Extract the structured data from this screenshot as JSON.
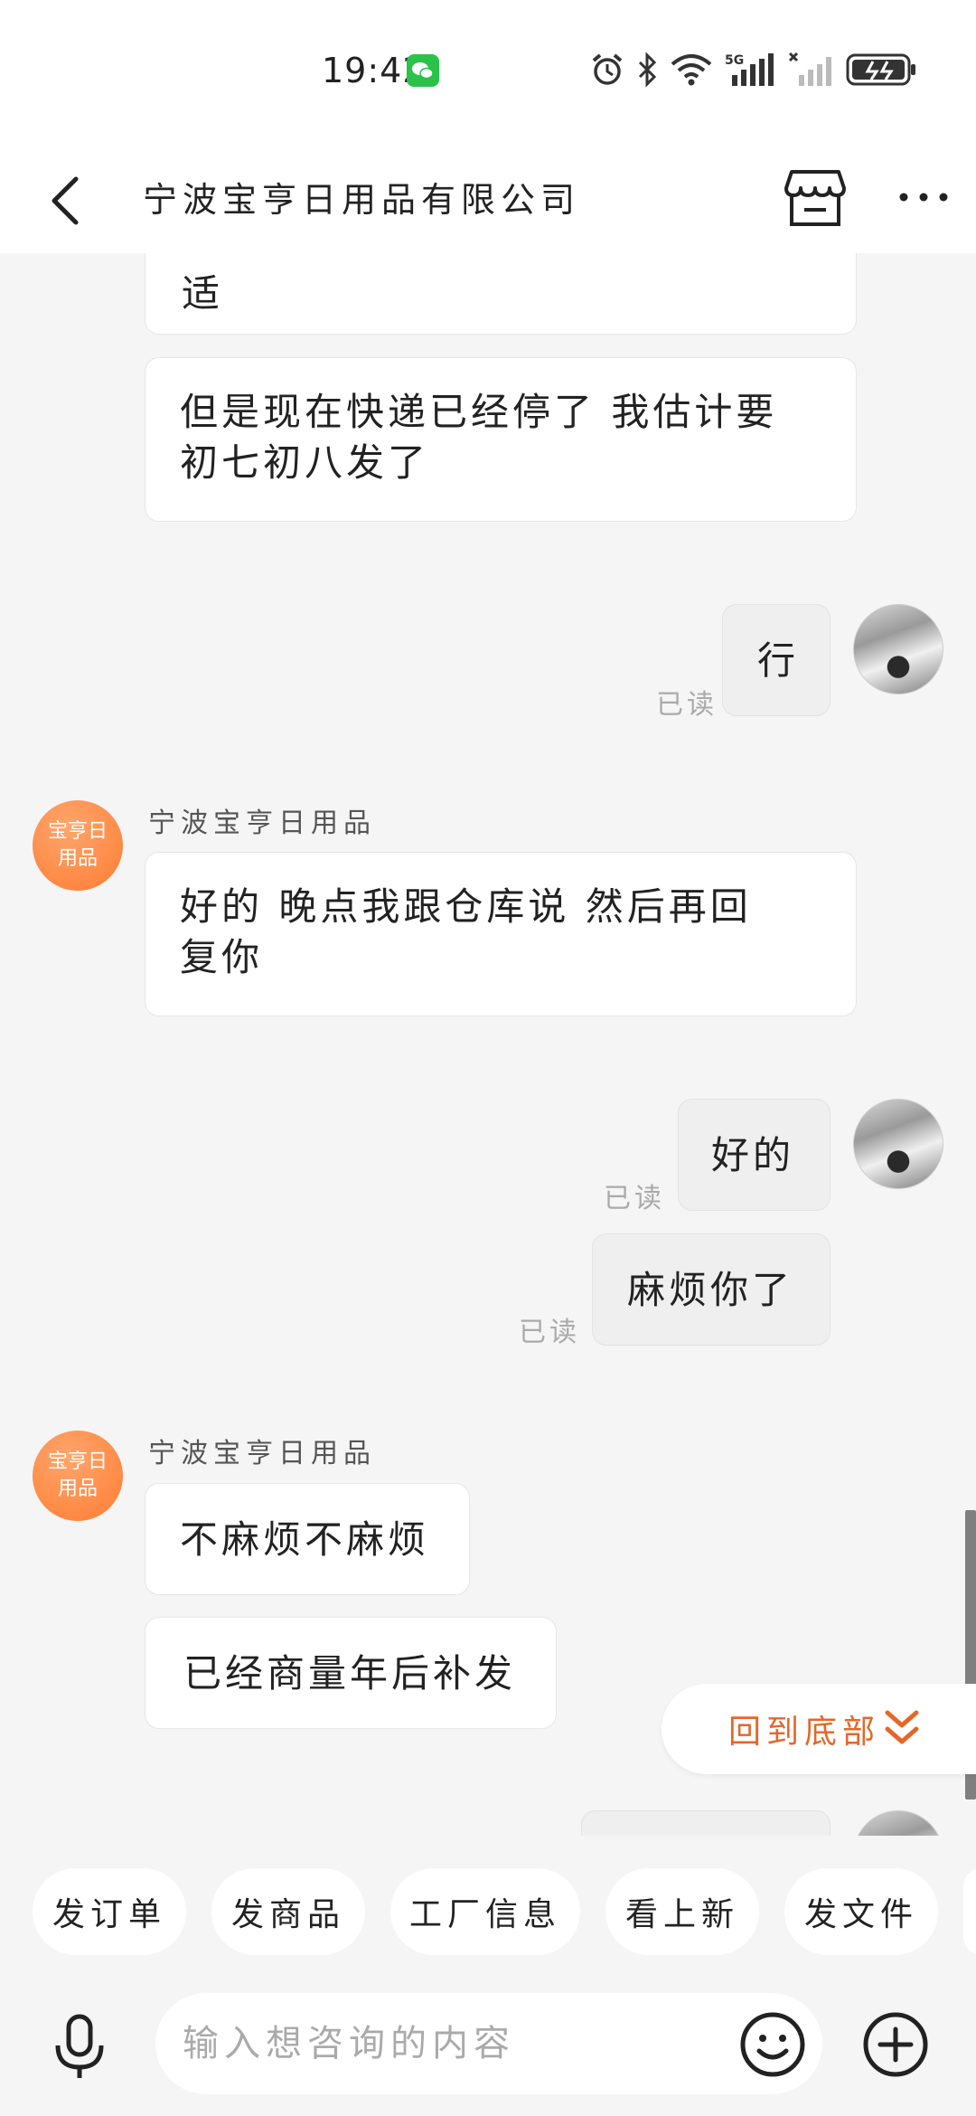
{
  "status_bar": {
    "time": "19:42",
    "network": "5G"
  },
  "header": {
    "title": "宁波宝亨日用品有限公司"
  },
  "shop": {
    "sender_name": "宁波宝亨日用品",
    "avatar_line1": "宝亨日",
    "avatar_line2": "用品"
  },
  "messages": [
    {
      "from": "shop",
      "text": "适"
    },
    {
      "from": "shop",
      "text_line1": "但是现在快递已经停了 我估计要",
      "text_line2": "初七初八发了"
    },
    {
      "from": "me",
      "text": "行",
      "status": "已读"
    },
    {
      "from": "shop",
      "text_line1": "好的 晚点我跟仓库说 然后再回",
      "text_line2": "复你"
    },
    {
      "from": "me",
      "text": "好的",
      "status": "已读"
    },
    {
      "from": "me",
      "text": "麻烦你了",
      "status": "已读"
    },
    {
      "from": "shop",
      "text": "不麻烦不麻烦"
    },
    {
      "from": "shop",
      "text": "已经商量年后补发"
    }
  ],
  "back_to_bottom": "回到底部",
  "quick_actions": [
    "发订单",
    "发商品",
    "工厂信息",
    "看上新",
    "发文件"
  ],
  "input": {
    "placeholder": "输入想咨询的内容"
  },
  "colors": {
    "accent": "#e4672a",
    "shop_avatar": "#ff8a40",
    "wechat": "#2bc24a"
  }
}
